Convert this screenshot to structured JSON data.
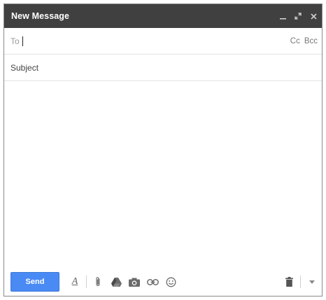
{
  "window": {
    "title": "New Message"
  },
  "to_field": {
    "label": "To",
    "value": "",
    "cc_label": "Cc",
    "bcc_label": "Bcc"
  },
  "subject_field": {
    "placeholder": "Subject",
    "value": ""
  },
  "toolbar": {
    "send_label": "Send"
  },
  "icons": {
    "minimize": "minimize-icon",
    "expand": "expand-icon",
    "close": "close-icon",
    "formatting": "text-format-icon",
    "attach": "paperclip-icon",
    "drive": "drive-icon",
    "photo": "camera-icon",
    "link": "link-icon",
    "emoji": "smiley-icon",
    "trash": "trash-icon",
    "more": "chevron-down-icon"
  },
  "colors": {
    "titlebar": "#404040",
    "send_button": "#4a8af4"
  }
}
